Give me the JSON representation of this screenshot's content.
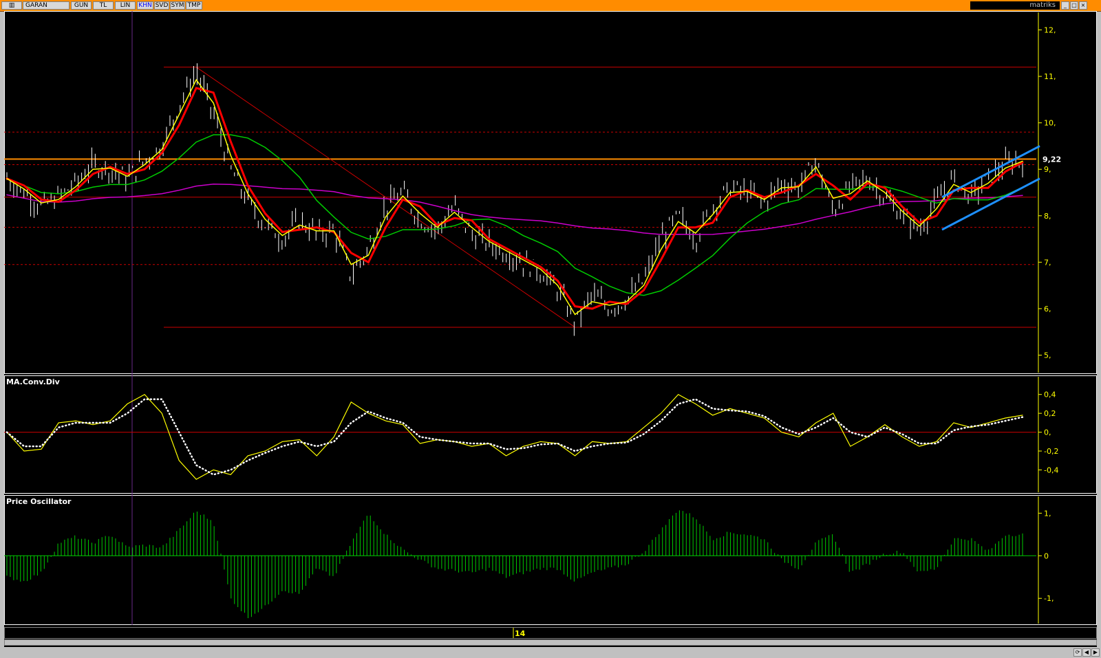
{
  "toolbar": {
    "symbol": "GARAN",
    "buttons": [
      "GUN",
      "TL",
      "LIN",
      "KHN",
      "SVD",
      "SYM",
      "TMP"
    ],
    "active_button": "KHN",
    "brand": "matriks"
  },
  "colors": {
    "background": "#000000",
    "price_bars": "#ffffff",
    "ma_fast": "#ffff00",
    "ma_slow": "#ff0000",
    "ma_mid": "#00cc00",
    "ma_long": "#cc00cc",
    "resistance": "#ff8c00",
    "channel": "#1e90ff",
    "level_lines": "#cc0000",
    "axis_text": "#ffff00",
    "histogram": "#00cc00"
  },
  "chart_data": [
    {
      "type": "line",
      "panel": "price",
      "ylim": [
        4.8,
        12.2
      ],
      "yticks": [
        "12,",
        "11,",
        "10,",
        "9,",
        "8,",
        "7,",
        "6,",
        "5,"
      ],
      "ytick_values": [
        12,
        11,
        10,
        9,
        8,
        7,
        6,
        5
      ],
      "last_value_label": "9,22",
      "last_value": 9.22,
      "x_label": "14",
      "series": [
        {
          "values": [
            8.8,
            8.5,
            8.2,
            8.4,
            8.7,
            9.1,
            9.0,
            8.8,
            9.2,
            9.5,
            10.4,
            11.1,
            10.2,
            9.0,
            8.3,
            7.8,
            7.5,
            7.9,
            7.6,
            7.7,
            6.7,
            7.3,
            8.2,
            8.5,
            7.9,
            7.7,
            8.2,
            7.6,
            7.4,
            7.2,
            7.0,
            6.8,
            6.4,
            5.7,
            6.3,
            6.0,
            6.2,
            6.6,
            7.5,
            8.0,
            7.5,
            8.2,
            8.6,
            8.5,
            8.3,
            8.7,
            8.6,
            9.2,
            8.1,
            8.6,
            8.8,
            8.4,
            8.0,
            7.7,
            8.3,
            8.8,
            8.4,
            8.8,
            9.1,
            9.2
          ]
        }
      ],
      "levels": [
        11.2,
        9.8,
        9.1,
        8.4,
        7.75,
        6.95,
        5.6
      ],
      "resistance": 9.22
    },
    {
      "type": "line",
      "panel": "macd",
      "title": "MA.Conv.Div",
      "ylim": [
        -0.55,
        0.5
      ],
      "yticks": [
        "0,4",
        "0,2",
        "0,",
        "-0,2",
        "-0,4"
      ],
      "ytick_values": [
        0.4,
        0.2,
        0,
        -0.2,
        -0.4
      ],
      "series": [
        {
          "values": [
            0.0,
            -0.2,
            -0.18,
            0.1,
            0.12,
            0.08,
            0.12,
            0.3,
            0.4,
            0.2,
            -0.3,
            -0.5,
            -0.4,
            -0.45,
            -0.25,
            -0.2,
            -0.1,
            -0.08,
            -0.25,
            -0.05,
            0.32,
            0.2,
            0.12,
            0.08,
            -0.12,
            -0.08,
            -0.1,
            -0.15,
            -0.12,
            -0.25,
            -0.15,
            -0.1,
            -0.12,
            -0.25,
            -0.1,
            -0.12,
            -0.1,
            0.05,
            0.2,
            0.4,
            0.3,
            0.18,
            0.25,
            0.2,
            0.15,
            0.0,
            -0.05,
            0.1,
            0.2,
            -0.15,
            -0.05,
            0.08,
            -0.05,
            -0.15,
            -0.1,
            0.1,
            0.05,
            0.1,
            0.15,
            0.18
          ]
        },
        {
          "values": [
            0.0,
            -0.15,
            -0.15,
            0.05,
            0.1,
            0.1,
            0.1,
            0.2,
            0.35,
            0.35,
            0.0,
            -0.35,
            -0.45,
            -0.4,
            -0.3,
            -0.22,
            -0.15,
            -0.1,
            -0.15,
            -0.1,
            0.1,
            0.22,
            0.15,
            0.1,
            -0.05,
            -0.08,
            -0.1,
            -0.12,
            -0.12,
            -0.18,
            -0.17,
            -0.13,
            -0.12,
            -0.2,
            -0.15,
            -0.12,
            -0.11,
            -0.02,
            0.12,
            0.3,
            0.35,
            0.25,
            0.23,
            0.22,
            0.17,
            0.05,
            -0.02,
            0.05,
            0.15,
            0.0,
            -0.05,
            0.05,
            -0.02,
            -0.12,
            -0.12,
            0.02,
            0.06,
            0.08,
            0.12,
            0.16
          ]
        }
      ]
    },
    {
      "type": "bar",
      "panel": "oscillator",
      "title": "Price Oscillator",
      "ylim": [
        -1.4,
        1.2
      ],
      "yticks": [
        "1,",
        "0",
        "-1,"
      ],
      "ytick_values": [
        1,
        0,
        -1
      ],
      "series": [
        {
          "values": [
            -0.5,
            -0.6,
            -0.4,
            0.3,
            0.45,
            0.3,
            0.5,
            0.2,
            0.25,
            0.2,
            0.6,
            1.05,
            0.8,
            -1.0,
            -1.45,
            -1.2,
            -0.8,
            -0.9,
            -0.3,
            -0.5,
            0.3,
            1.0,
            0.5,
            0.15,
            -0.1,
            -0.3,
            -0.35,
            -0.4,
            -0.3,
            -0.5,
            -0.4,
            -0.3,
            -0.3,
            -0.6,
            -0.4,
            -0.3,
            -0.2,
            0.1,
            0.6,
            1.1,
            0.9,
            0.4,
            0.55,
            0.5,
            0.4,
            -0.1,
            -0.3,
            0.3,
            0.5,
            -0.4,
            -0.2,
            0.05,
            0.1,
            -0.4,
            -0.3,
            0.4,
            0.4,
            0.1,
            0.5,
            0.5
          ]
        }
      ]
    }
  ]
}
